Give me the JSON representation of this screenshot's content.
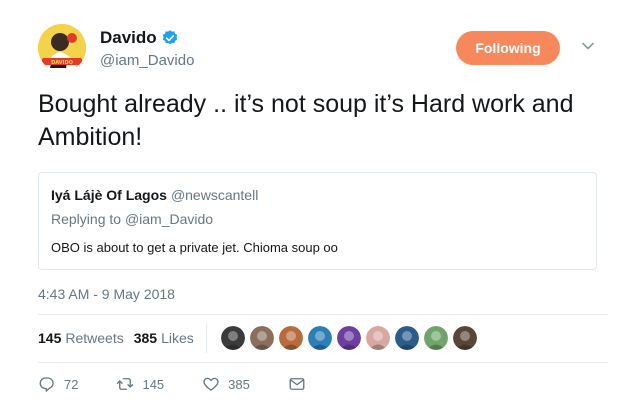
{
  "author": {
    "display_name": "Davido",
    "handle": "@iam_Davido",
    "verified_icon": "verified-badge-icon",
    "avatar_label": "DAVIDO"
  },
  "follow_button": {
    "label": "Following",
    "color": "#f7885b"
  },
  "tweet": {
    "text": "Bought already .. it’s not soup it’s Hard work and Ambition!"
  },
  "quoted_tweet": {
    "name": "Iyá Lájè Of Lagos",
    "handle": "@newscantell",
    "replying_to_prefix": "Replying to ",
    "replying_to_handle": "@iam_Davido",
    "text": "OBO is about to get a private jet. Chioma soup oo"
  },
  "timestamp": "4:43 AM - 9 May 2018",
  "stats": {
    "retweets_count": "145",
    "retweets_label": "Retweets",
    "likes_count": "385",
    "likes_label": "Likes",
    "liker_avatars": [
      {
        "color": "#3b3b3b"
      },
      {
        "color": "#8a6f5c"
      },
      {
        "color": "#b86b3c"
      },
      {
        "color": "#2d7fb8"
      },
      {
        "color": "#6c3fa0"
      },
      {
        "color": "#d8a8a0"
      },
      {
        "color": "#2a5d8a"
      },
      {
        "color": "#6fa46a"
      },
      {
        "color": "#5a4638"
      }
    ]
  },
  "actions": {
    "reply_count": "72",
    "retweet_count": "145",
    "like_count": "385"
  },
  "colors": {
    "text": "#14171a",
    "secondary": "#657786",
    "verified": "#1da1f2",
    "border": "#e1e8ed"
  }
}
